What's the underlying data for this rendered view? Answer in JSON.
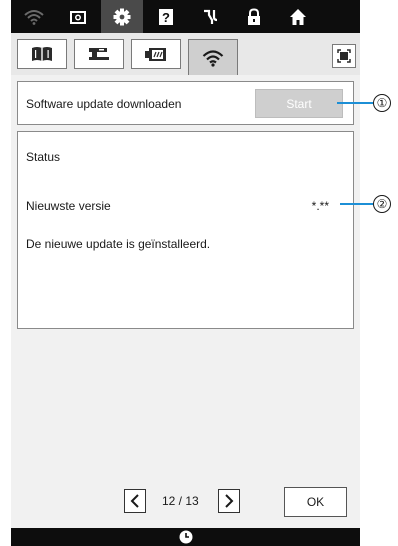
{
  "topbar": {
    "icons": [
      "wifi-icon",
      "camera-icon",
      "gear-icon",
      "help-icon",
      "thread-icon",
      "lock-icon",
      "home-icon"
    ],
    "active": "gear-icon"
  },
  "tabs": {
    "items": [
      "sewing-guide-tab",
      "machine-tab",
      "embroidery-tab",
      "wifi-tab"
    ],
    "active": "wifi-tab"
  },
  "update": {
    "label": "Software update downloaden",
    "start_label": "Start"
  },
  "status": {
    "title": "Status",
    "version_label": "Nieuwste versie",
    "version_value": "*.**",
    "message": "De nieuwe update is geïnstalleerd."
  },
  "pager": {
    "text": "12 / 13"
  },
  "ok_label": "OK",
  "callouts": [
    "①",
    "②"
  ],
  "colors": {
    "callout_line": "#1c8fd6",
    "topbar": "#0d0d0d",
    "start_disabled": "#cfcfcf"
  }
}
